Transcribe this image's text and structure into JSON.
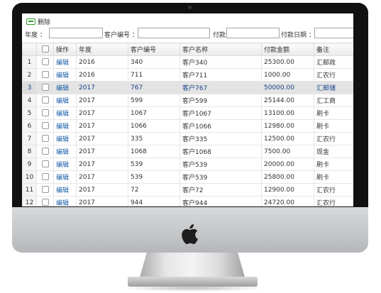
{
  "toolbar": {
    "delete_label": "删除"
  },
  "filters": {
    "year_label": "年度 ：",
    "customer_no_label": "客户编号 ：",
    "amount_label": "付款金额 ：",
    "date_label": "付款日期 ："
  },
  "table": {
    "headers": {
      "op": "操作",
      "year": "年度",
      "customer_no": "客户编号",
      "customer_name": "客户名称",
      "amount": "付款金额",
      "note": "备注"
    },
    "rows": [
      {
        "num": "1",
        "op": "编辑",
        "year": "2016",
        "customer_no": "340",
        "customer_name": "客户340",
        "amount": "25300.00",
        "note": "汇邮政"
      },
      {
        "num": "2",
        "op": "编辑",
        "year": "2016",
        "customer_no": "711",
        "customer_name": "客户711",
        "amount": "1000.00",
        "note": "汇农行"
      },
      {
        "num": "3",
        "op": "编辑",
        "year": "2017",
        "customer_no": "767",
        "customer_name": "客户767",
        "amount": "50000.00",
        "note": "汇邮储"
      },
      {
        "num": "4",
        "op": "编辑",
        "year": "2017",
        "customer_no": "599",
        "customer_name": "客户599",
        "amount": "25144.00",
        "note": "汇工商"
      },
      {
        "num": "5",
        "op": "编辑",
        "year": "2017",
        "customer_no": "1067",
        "customer_name": "客户1067",
        "amount": "13100.00",
        "note": "刷卡"
      },
      {
        "num": "6",
        "op": "编辑",
        "year": "2017",
        "customer_no": "1066",
        "customer_name": "客户1066",
        "amount": "12980.00",
        "note": "刷卡"
      },
      {
        "num": "7",
        "op": "编辑",
        "year": "2017",
        "customer_no": "335",
        "customer_name": "客户335",
        "amount": "12500.00",
        "note": "汇农行"
      },
      {
        "num": "8",
        "op": "编辑",
        "year": "2017",
        "customer_no": "1068",
        "customer_name": "客户1068",
        "amount": "7500.00",
        "note": "现金"
      },
      {
        "num": "9",
        "op": "编辑",
        "year": "2017",
        "customer_no": "539",
        "customer_name": "客户539",
        "amount": "20000.00",
        "note": "刷卡"
      },
      {
        "num": "10",
        "op": "编辑",
        "year": "2017",
        "customer_no": "539",
        "customer_name": "客户539",
        "amount": "25800.00",
        "note": "刷卡"
      },
      {
        "num": "11",
        "op": "编辑",
        "year": "2017",
        "customer_no": "72",
        "customer_name": "客户72",
        "amount": "12900.00",
        "note": "汇农行"
      },
      {
        "num": "12",
        "op": "编辑",
        "year": "2017",
        "customer_no": "944",
        "customer_name": "客户944",
        "amount": "24720.00",
        "note": "汇农行"
      }
    ],
    "selected_row": 3
  },
  "colors": {
    "accent_link": "#1a5fa8",
    "delete_icon": "#2e9b2e",
    "selected_row": "#e3e3e3"
  },
  "icons": {
    "delete": "minus-box-icon",
    "brand": "apple-logo-icon"
  }
}
